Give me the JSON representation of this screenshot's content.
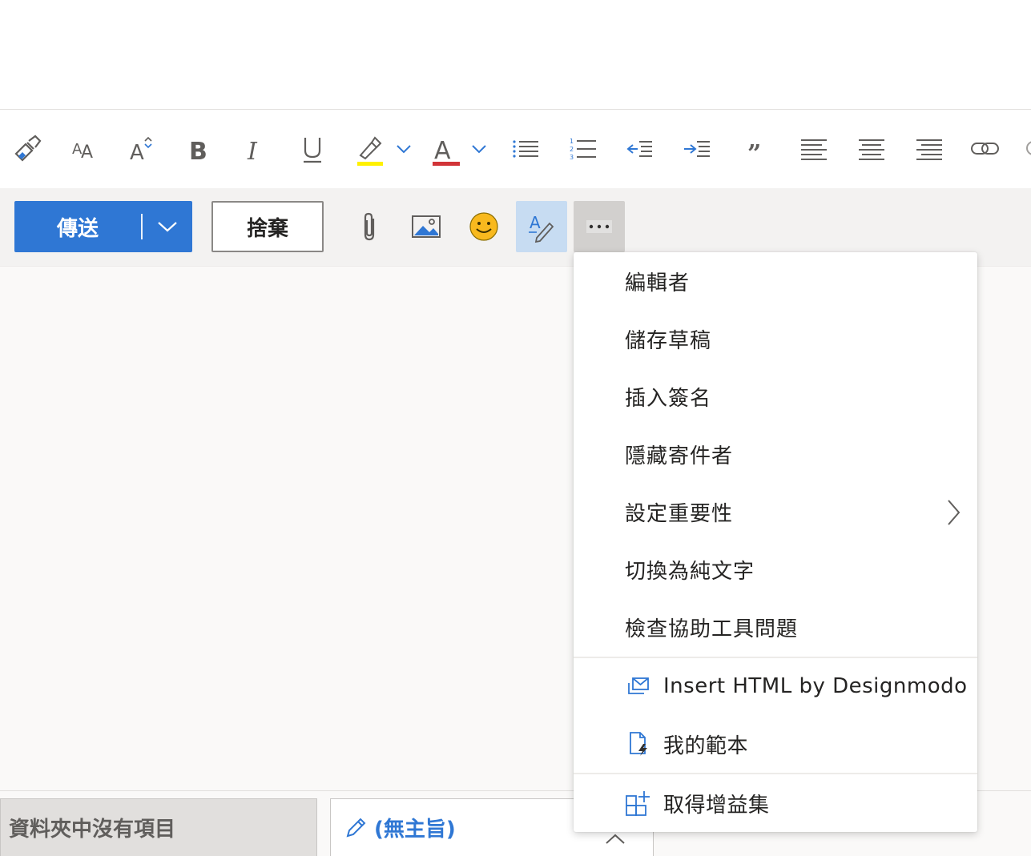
{
  "format_toolbar": {
    "icons": [
      "format-painter-icon",
      "font-size-icon",
      "grow-font-icon",
      "bold-icon",
      "italic-icon",
      "underline-icon",
      "highlight-icon",
      "font-color-icon",
      "bullets-icon",
      "numbering-icon",
      "decrease-indent-icon",
      "increase-indent-icon",
      "quote-icon",
      "align-left-icon",
      "align-center-icon",
      "align-right-icon",
      "link-icon"
    ],
    "highlight_color": "#fff100",
    "font_color": "#d13438"
  },
  "actions": {
    "send_label": "傳送",
    "discard_label": "捨棄"
  },
  "menu": {
    "items": [
      {
        "label": "編輯者"
      },
      {
        "label": "儲存草稿"
      },
      {
        "label": "插入簽名"
      },
      {
        "label": "隱藏寄件者"
      },
      {
        "label": "設定重要性",
        "has_submenu": true
      },
      {
        "label": "切換為純文字"
      },
      {
        "label": "檢查協助工具問題"
      }
    ],
    "addins": [
      {
        "label": "Insert HTML by Designmodo",
        "icon": "mail-html-icon"
      },
      {
        "label": "我的範本",
        "icon": "template-icon"
      }
    ],
    "get_addins_label": "取得增益集"
  },
  "bottom": {
    "folder_empty_label": "資料夾中沒有項目",
    "draft_tab_label": "(無主旨)"
  },
  "colors": {
    "accent": "#2f77d4",
    "editor_active_bg": "#c7dcf2",
    "more_active_bg": "#d2d0ce"
  }
}
